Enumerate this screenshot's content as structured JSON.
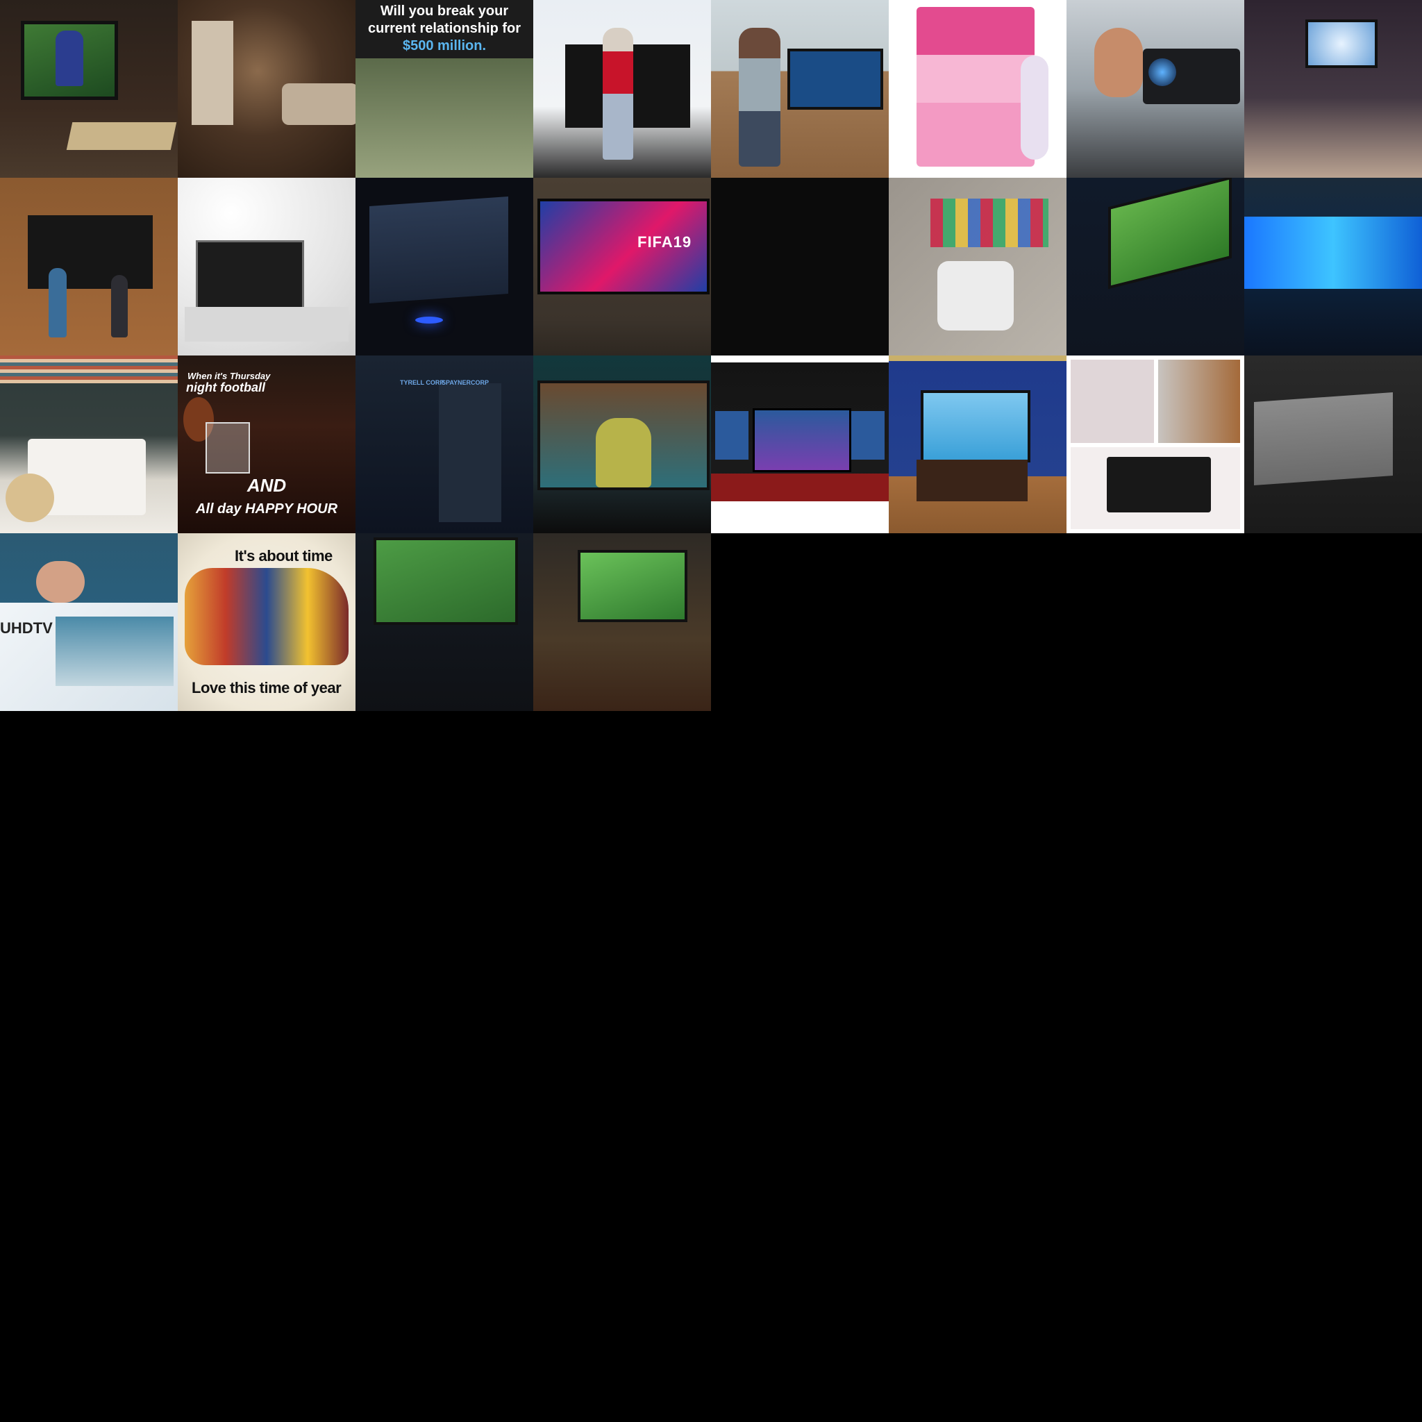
{
  "title": "",
  "tiles": [
    {
      "id": 1,
      "caption": ""
    },
    {
      "id": 2,
      "caption": ""
    },
    {
      "id": 3,
      "caption": "Will you break your current relationship for",
      "highlight": "$500 million."
    },
    {
      "id": 4,
      "caption": ""
    },
    {
      "id": 5,
      "caption": ""
    },
    {
      "id": 6,
      "caption": ""
    },
    {
      "id": 7,
      "caption": ""
    },
    {
      "id": 8,
      "caption": ""
    },
    {
      "id": 9,
      "caption": ""
    },
    {
      "id": 10,
      "caption": ""
    },
    {
      "id": 11,
      "caption": ""
    },
    {
      "id": 12,
      "caption": "FIFA19"
    },
    {
      "id": 13,
      "caption": ""
    },
    {
      "id": 14,
      "caption": ""
    },
    {
      "id": 15,
      "caption": ""
    },
    {
      "id": 16,
      "caption": ""
    },
    {
      "id": 17,
      "caption": ""
    },
    {
      "id": 18,
      "caption_line1": "When it's Thursday",
      "caption_line2": "night football",
      "caption_line3": "AND",
      "caption_line4": "All day HAPPY HOUR"
    },
    {
      "id": 19,
      "sign1": "TYRELL CORP",
      "sign2": "SPAYNERCORP"
    },
    {
      "id": 20,
      "caption": ""
    },
    {
      "id": 21,
      "caption": ""
    },
    {
      "id": 22,
      "caption": ""
    },
    {
      "id": 23,
      "caption": ""
    },
    {
      "id": 24,
      "caption": ""
    },
    {
      "id": 25,
      "caption": "UHDTV"
    },
    {
      "id": 26,
      "title": "It's about time",
      "subtitle": "Love this time of year"
    },
    {
      "id": 27,
      "caption": ""
    },
    {
      "id": 28,
      "caption": ""
    }
  ]
}
